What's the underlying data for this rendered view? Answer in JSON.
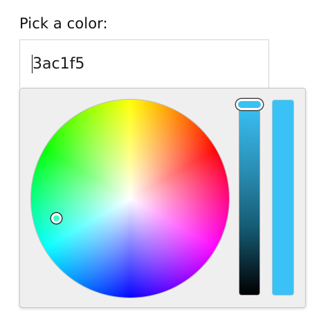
{
  "picker": {
    "label": "Pick a color:",
    "input_value": "3ac1f5",
    "selected_color": "#3ac1f5",
    "brightness_level": 1.0
  },
  "icons": {
    "wheel_handle": "circle-handle",
    "slider_thumb": "pill-thumb"
  }
}
